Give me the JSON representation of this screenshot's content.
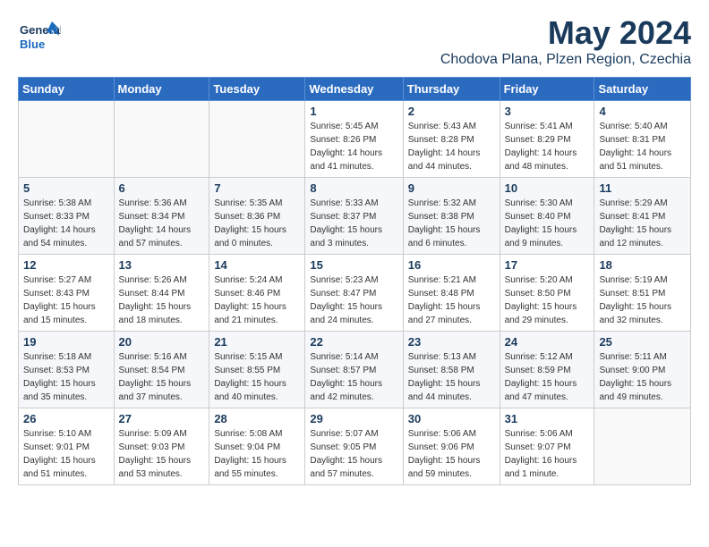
{
  "header": {
    "logo_general": "General",
    "logo_blue": "Blue",
    "title": "May 2024",
    "subtitle": "Chodova Plana, Plzen Region, Czechia"
  },
  "calendar": {
    "weekdays": [
      "Sunday",
      "Monday",
      "Tuesday",
      "Wednesday",
      "Thursday",
      "Friday",
      "Saturday"
    ],
    "weeks": [
      [
        {
          "day": "",
          "info": ""
        },
        {
          "day": "",
          "info": ""
        },
        {
          "day": "",
          "info": ""
        },
        {
          "day": "1",
          "info": "Sunrise: 5:45 AM\nSunset: 8:26 PM\nDaylight: 14 hours\nand 41 minutes."
        },
        {
          "day": "2",
          "info": "Sunrise: 5:43 AM\nSunset: 8:28 PM\nDaylight: 14 hours\nand 44 minutes."
        },
        {
          "day": "3",
          "info": "Sunrise: 5:41 AM\nSunset: 8:29 PM\nDaylight: 14 hours\nand 48 minutes."
        },
        {
          "day": "4",
          "info": "Sunrise: 5:40 AM\nSunset: 8:31 PM\nDaylight: 14 hours\nand 51 minutes."
        }
      ],
      [
        {
          "day": "5",
          "info": "Sunrise: 5:38 AM\nSunset: 8:33 PM\nDaylight: 14 hours\nand 54 minutes."
        },
        {
          "day": "6",
          "info": "Sunrise: 5:36 AM\nSunset: 8:34 PM\nDaylight: 14 hours\nand 57 minutes."
        },
        {
          "day": "7",
          "info": "Sunrise: 5:35 AM\nSunset: 8:36 PM\nDaylight: 15 hours\nand 0 minutes."
        },
        {
          "day": "8",
          "info": "Sunrise: 5:33 AM\nSunset: 8:37 PM\nDaylight: 15 hours\nand 3 minutes."
        },
        {
          "day": "9",
          "info": "Sunrise: 5:32 AM\nSunset: 8:38 PM\nDaylight: 15 hours\nand 6 minutes."
        },
        {
          "day": "10",
          "info": "Sunrise: 5:30 AM\nSunset: 8:40 PM\nDaylight: 15 hours\nand 9 minutes."
        },
        {
          "day": "11",
          "info": "Sunrise: 5:29 AM\nSunset: 8:41 PM\nDaylight: 15 hours\nand 12 minutes."
        }
      ],
      [
        {
          "day": "12",
          "info": "Sunrise: 5:27 AM\nSunset: 8:43 PM\nDaylight: 15 hours\nand 15 minutes."
        },
        {
          "day": "13",
          "info": "Sunrise: 5:26 AM\nSunset: 8:44 PM\nDaylight: 15 hours\nand 18 minutes."
        },
        {
          "day": "14",
          "info": "Sunrise: 5:24 AM\nSunset: 8:46 PM\nDaylight: 15 hours\nand 21 minutes."
        },
        {
          "day": "15",
          "info": "Sunrise: 5:23 AM\nSunset: 8:47 PM\nDaylight: 15 hours\nand 24 minutes."
        },
        {
          "day": "16",
          "info": "Sunrise: 5:21 AM\nSunset: 8:48 PM\nDaylight: 15 hours\nand 27 minutes."
        },
        {
          "day": "17",
          "info": "Sunrise: 5:20 AM\nSunset: 8:50 PM\nDaylight: 15 hours\nand 29 minutes."
        },
        {
          "day": "18",
          "info": "Sunrise: 5:19 AM\nSunset: 8:51 PM\nDaylight: 15 hours\nand 32 minutes."
        }
      ],
      [
        {
          "day": "19",
          "info": "Sunrise: 5:18 AM\nSunset: 8:53 PM\nDaylight: 15 hours\nand 35 minutes."
        },
        {
          "day": "20",
          "info": "Sunrise: 5:16 AM\nSunset: 8:54 PM\nDaylight: 15 hours\nand 37 minutes."
        },
        {
          "day": "21",
          "info": "Sunrise: 5:15 AM\nSunset: 8:55 PM\nDaylight: 15 hours\nand 40 minutes."
        },
        {
          "day": "22",
          "info": "Sunrise: 5:14 AM\nSunset: 8:57 PM\nDaylight: 15 hours\nand 42 minutes."
        },
        {
          "day": "23",
          "info": "Sunrise: 5:13 AM\nSunset: 8:58 PM\nDaylight: 15 hours\nand 44 minutes."
        },
        {
          "day": "24",
          "info": "Sunrise: 5:12 AM\nSunset: 8:59 PM\nDaylight: 15 hours\nand 47 minutes."
        },
        {
          "day": "25",
          "info": "Sunrise: 5:11 AM\nSunset: 9:00 PM\nDaylight: 15 hours\nand 49 minutes."
        }
      ],
      [
        {
          "day": "26",
          "info": "Sunrise: 5:10 AM\nSunset: 9:01 PM\nDaylight: 15 hours\nand 51 minutes."
        },
        {
          "day": "27",
          "info": "Sunrise: 5:09 AM\nSunset: 9:03 PM\nDaylight: 15 hours\nand 53 minutes."
        },
        {
          "day": "28",
          "info": "Sunrise: 5:08 AM\nSunset: 9:04 PM\nDaylight: 15 hours\nand 55 minutes."
        },
        {
          "day": "29",
          "info": "Sunrise: 5:07 AM\nSunset: 9:05 PM\nDaylight: 15 hours\nand 57 minutes."
        },
        {
          "day": "30",
          "info": "Sunrise: 5:06 AM\nSunset: 9:06 PM\nDaylight: 15 hours\nand 59 minutes."
        },
        {
          "day": "31",
          "info": "Sunrise: 5:06 AM\nSunset: 9:07 PM\nDaylight: 16 hours\nand 1 minute."
        },
        {
          "day": "",
          "info": ""
        }
      ]
    ]
  }
}
